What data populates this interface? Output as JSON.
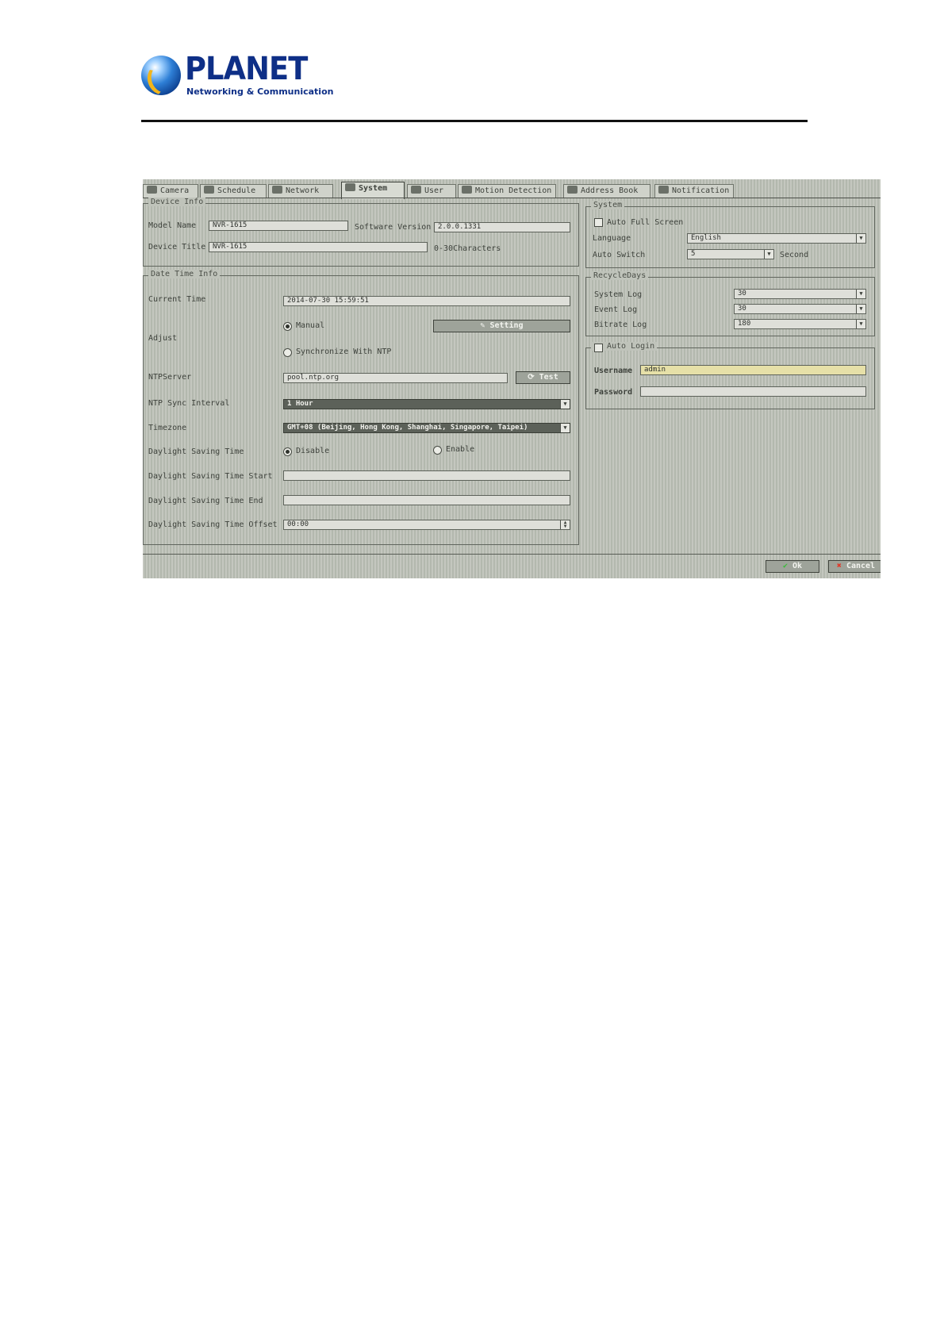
{
  "brand": {
    "name": "PLANET",
    "tagline": "Networking & Communication",
    "colors": {
      "primary": "#0e2f87",
      "accent": "#f2b51a"
    }
  },
  "tabs": [
    {
      "label": "Camera",
      "icon": "camera-icon"
    },
    {
      "label": "Schedule",
      "icon": "schedule-icon"
    },
    {
      "label": "Network",
      "icon": "network-icon"
    },
    {
      "label": "System",
      "icon": "system-icon",
      "active": true
    },
    {
      "label": "User",
      "icon": "user-icon"
    },
    {
      "label": "Motion Detection",
      "icon": "motion-icon"
    },
    {
      "label": "Address Book",
      "icon": "address-book-icon"
    },
    {
      "label": "Notification",
      "icon": "notification-icon"
    }
  ],
  "device_info": {
    "title": "Device Info",
    "model_name_label": "Model Name",
    "model_name_value": "NVR-1615",
    "software_version_label": "Software Version",
    "software_version_value": "2.0.0.1331",
    "device_title_label": "Device Title",
    "device_title_value": "NVR-1615",
    "device_title_hint": "0-30Characters"
  },
  "date_time_info": {
    "title": "Date Time Info",
    "current_time_label": "Current Time",
    "current_time_value": "2014-07-30 15:59:51",
    "adjust_label": "Adjust",
    "manual_label": "Manual",
    "setting_button": "Setting",
    "sync_ntp_label": "Synchronize With NTP",
    "ntp_server_label": "NTPServer",
    "ntp_server_value": "pool.ntp.org",
    "test_button": "Test",
    "ntp_interval_label": "NTP Sync Interval",
    "ntp_interval_value": "1 Hour",
    "timezone_label": "Timezone",
    "timezone_value": "GMT+08 (Beijing, Hong Kong, Shanghai, Singapore, Taipei)",
    "dst_label": "Daylight Saving Time",
    "dst_disable": "Disable",
    "dst_enable": "Enable",
    "dst_start_label": "Daylight Saving Time Start",
    "dst_start_value": "",
    "dst_end_label": "Daylight Saving Time End",
    "dst_end_value": "",
    "dst_offset_label": "Daylight Saving Time Offset",
    "dst_offset_value": "00:00"
  },
  "system": {
    "title": "System",
    "auto_full_screen_label": "Auto Full Screen",
    "language_label": "Language",
    "language_value": "English",
    "auto_switch_label": "Auto Switch",
    "auto_switch_value": "5",
    "auto_switch_unit": "Second"
  },
  "recycle_days": {
    "title": "RecycleDays",
    "system_log_label": "System Log",
    "system_log_value": "30",
    "event_log_label": "Event Log",
    "event_log_value": "30",
    "bitrate_log_label": "Bitrate Log",
    "bitrate_log_value": "180"
  },
  "auto_login": {
    "title": "Auto Login",
    "username_label": "Username",
    "username_value": "admin",
    "password_label": "Password",
    "password_value": ""
  },
  "footer": {
    "ok_button": "Ok",
    "cancel_button": "Cancel"
  }
}
